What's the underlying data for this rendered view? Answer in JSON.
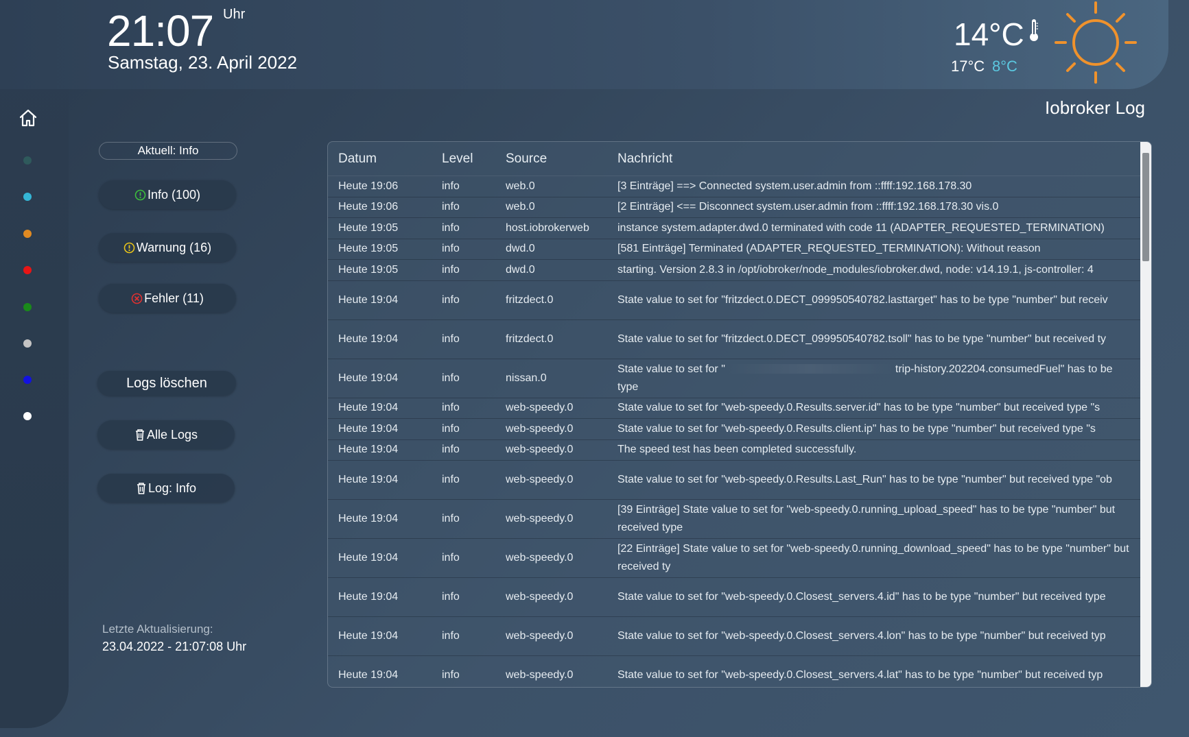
{
  "header": {
    "time": "21:07",
    "time_unit": "Uhr",
    "date": "Samstag, 23. April 2022"
  },
  "weather": {
    "current_temp": "14°C",
    "max_temp": "17°C",
    "min_temp": "8°C",
    "icon": "sun-icon",
    "thermometer_icon": "thermometer-icon",
    "sun_color": "#f0922c",
    "min_color": "#5bc8e0"
  },
  "page_title": "Iobroker Log",
  "nav": {
    "home_icon": "home-icon",
    "dots": [
      {
        "name": "nav-dot-dark-teal",
        "color": "#2f5a5c"
      },
      {
        "name": "nav-dot-cyan",
        "color": "#35b6d6"
      },
      {
        "name": "nav-dot-orange",
        "color": "#e08a22"
      },
      {
        "name": "nav-dot-red",
        "color": "#e81515"
      },
      {
        "name": "nav-dot-green",
        "color": "#1a8a1a"
      },
      {
        "name": "nav-dot-grey",
        "color": "#c4c4c4"
      },
      {
        "name": "nav-dot-blue",
        "color": "#1212e0"
      },
      {
        "name": "nav-dot-white",
        "color": "#ffffff"
      }
    ]
  },
  "filters": {
    "current": "Aktuell: Info",
    "info": "Info (100)",
    "warning": "Warnung (16)",
    "error": "Fehler (11)",
    "clear_logs": "Logs löschen",
    "all_logs": "Alle Logs",
    "log_info": "Log: Info",
    "info_color": "#3dbf3d",
    "warning_color": "#e8c31a",
    "error_color": "#e03030"
  },
  "updated": {
    "label": "Letzte Aktualisierung:",
    "value": "23.04.2022 - 21:07:08 Uhr"
  },
  "log": {
    "columns": {
      "date": "Datum",
      "level": "Level",
      "source": "Source",
      "message": "Nachricht"
    },
    "rows": [
      {
        "date": "Heute 19:06",
        "level": "info",
        "source": "web.0",
        "message": "[3 Einträge] ==> Connected system.user.admin from ::ffff:192.168.178.30"
      },
      {
        "date": "Heute 19:06",
        "level": "info",
        "source": "web.0",
        "message": "[2 Einträge] <== Disconnect system.user.admin from ::ffff:192.168.178.30 vis.0"
      },
      {
        "date": "Heute 19:05",
        "level": "info",
        "source": "host.iobrokerweb",
        "message": "instance system.adapter.dwd.0 terminated with code 11 (ADAPTER_REQUESTED_TERMINATION)"
      },
      {
        "date": "Heute 19:05",
        "level": "info",
        "source": "dwd.0",
        "message": "[581 Einträge] Terminated (ADAPTER_REQUESTED_TERMINATION): Without reason"
      },
      {
        "date": "Heute 19:05",
        "level": "info",
        "source": "dwd.0",
        "message": "starting. Version 2.8.3 in /opt/iobroker/node_modules/iobroker.dwd, node: v14.19.1, js-controller: 4"
      },
      {
        "date": "Heute 19:04",
        "level": "info",
        "source": "fritzdect.0",
        "message": "State value to set for \"fritzdect.0.DECT_099950540782.lasttarget\" has to be type \"number\" but receiv"
      },
      {
        "date": "Heute 19:04",
        "level": "info",
        "source": "fritzdect.0",
        "message": "State value to set for \"fritzdect.0.DECT_099950540782.tsoll\" has to be type \"number\" but received ty"
      },
      {
        "date": "Heute 19:04",
        "level": "info",
        "source": "nissan.0",
        "message_pre": "State value to set for \"",
        "message_post": "trip-history.202204.consumedFuel\" has to be type"
      },
      {
        "date": "Heute 19:04",
        "level": "info",
        "source": "web-speedy.0",
        "message": "State value to set for \"web-speedy.0.Results.server.id\" has to be type \"number\" but received type \"s"
      },
      {
        "date": "Heute 19:04",
        "level": "info",
        "source": "web-speedy.0",
        "message": "State value to set for \"web-speedy.0.Results.client.ip\" has to be type \"number\" but received type \"s"
      },
      {
        "date": "Heute 19:04",
        "level": "info",
        "source": "web-speedy.0",
        "message": "The speed test has been completed successfully."
      },
      {
        "date": "Heute 19:04",
        "level": "info",
        "source": "web-speedy.0",
        "message": "State value to set for \"web-speedy.0.Results.Last_Run\" has to be type \"number\" but received type \"ob"
      },
      {
        "date": "Heute 19:04",
        "level": "info",
        "source": "web-speedy.0",
        "message": "[39 Einträge] State value to set for \"web-speedy.0.running_upload_speed\" has to be type \"number\" but received type"
      },
      {
        "date": "Heute 19:04",
        "level": "info",
        "source": "web-speedy.0",
        "message": "[22 Einträge] State value to set for \"web-speedy.0.running_download_speed\" has to be type \"number\" but received ty"
      },
      {
        "date": "Heute 19:04",
        "level": "info",
        "source": "web-speedy.0",
        "message": "State value to set for \"web-speedy.0.Closest_servers.4.id\" has to be type \"number\" but received type"
      },
      {
        "date": "Heute 19:04",
        "level": "info",
        "source": "web-speedy.0",
        "message": "State value to set for \"web-speedy.0.Closest_servers.4.lon\" has to be type \"number\" but received typ"
      },
      {
        "date": "Heute 19:04",
        "level": "info",
        "source": "web-speedy.0",
        "message": "State value to set for \"web-speedy.0.Closest_servers.4.lat\" has to be type \"number\" but received typ"
      }
    ]
  }
}
